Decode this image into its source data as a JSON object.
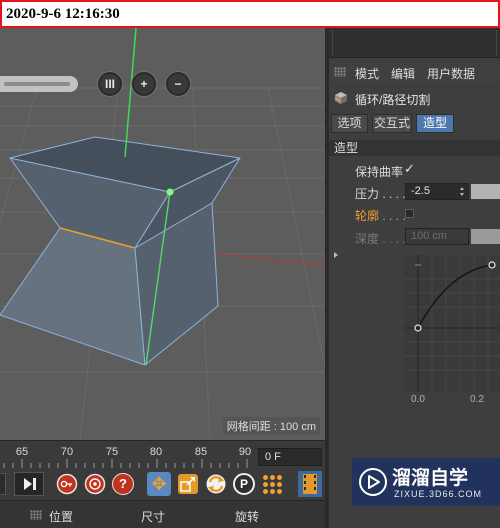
{
  "timestamp": "2020-9-6 12:16:30",
  "viewport": {
    "zoom_buttons": [
      "III",
      "+",
      "−"
    ],
    "grid_spacing": "网格间距 : 100 cm"
  },
  "attributes": {
    "menu": [
      "模式",
      "编辑",
      "用户数据"
    ],
    "title": "循环/路径切割",
    "tabs": [
      "选项",
      "交互式",
      "造型"
    ],
    "active_tab": "造型",
    "section": "造型",
    "keep_curvature": {
      "label": "保持曲率",
      "checked": true
    },
    "pressure": {
      "label": "压力 . . . .",
      "value": "-2.5"
    },
    "contour": {
      "label": "轮廓 . . . .",
      "checked": false
    },
    "depth": {
      "label": "深度 . . . .",
      "value": "100 cm"
    },
    "graph": {
      "x_labels": [
        "0.0",
        "0.2"
      ]
    }
  },
  "timeline": {
    "ticks": [
      "65",
      "70",
      "75",
      "80",
      "85",
      "90"
    ],
    "frame": "0 F"
  },
  "coordinates": {
    "labels": [
      "位置",
      "尺寸",
      "旋转"
    ]
  },
  "glyphs": {
    "check": "✓",
    "help": "?",
    "move": "✥",
    "p": "P"
  },
  "watermark": {
    "brand": "溜溜自学",
    "url": "ZIXUE.3D66.COM"
  },
  "colors": {
    "accent_blue": "#4b79ad",
    "highlight_orange": "#f0a030",
    "timestamp_border": "#e3141c",
    "axis_green": "#3ddc54"
  },
  "icons": [
    "zoom-bars-icon",
    "zoom-in-icon",
    "zoom-out-icon",
    "grip-icon",
    "loop-cut-tool-icon",
    "checkmark-icon",
    "goto-end-icon",
    "record-key-icon",
    "auto-key-icon",
    "keyframe-help-icon",
    "move-tool-icon",
    "scale-tool-icon",
    "rotate-tool-icon",
    "p-icon",
    "snap-dots-icon",
    "film-icon",
    "watermark-logo-icon"
  ]
}
